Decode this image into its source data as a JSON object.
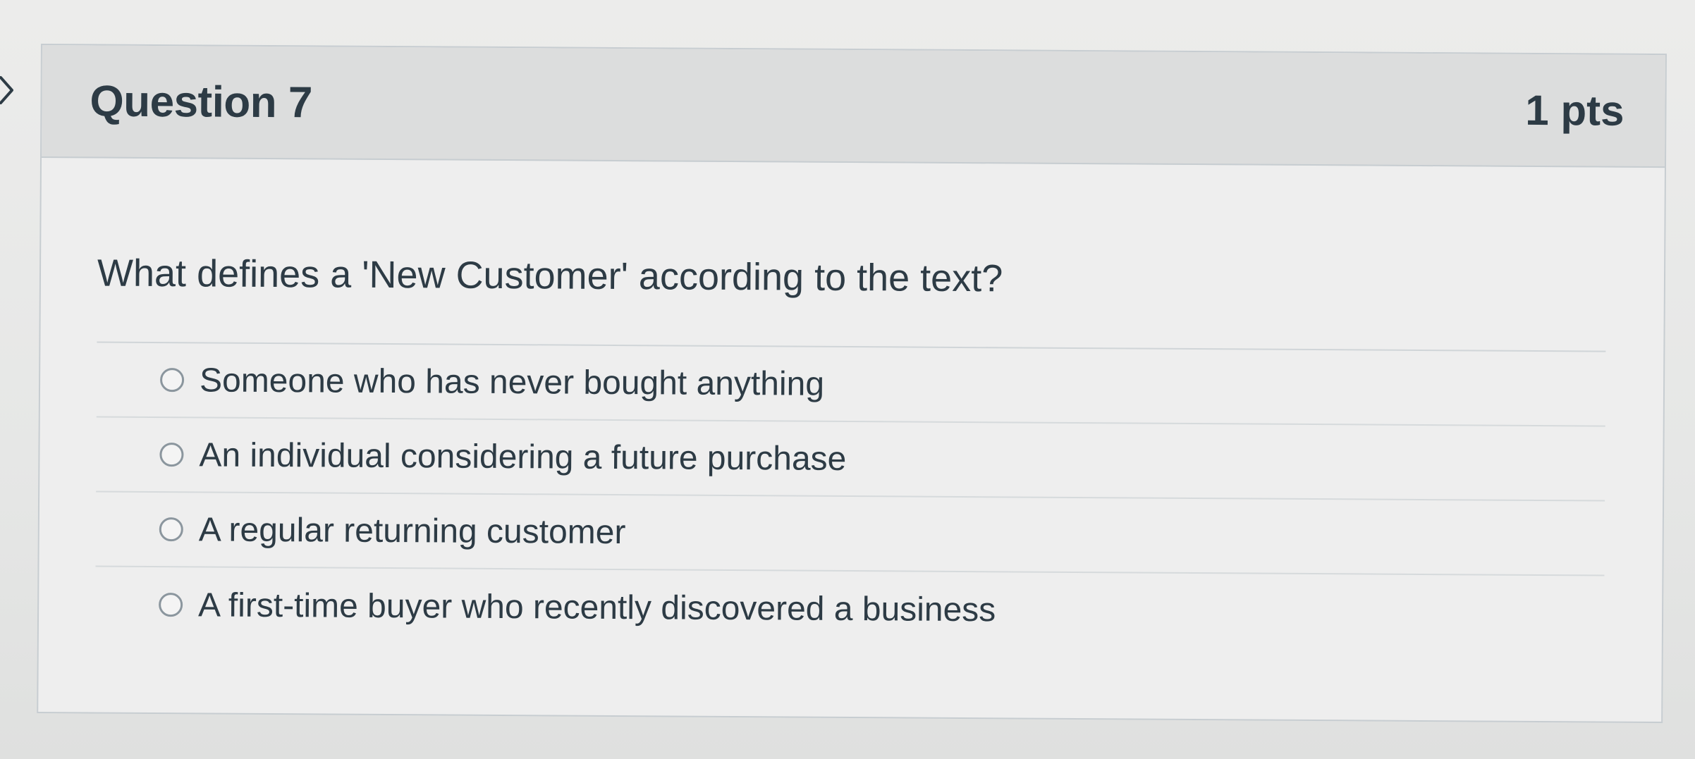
{
  "question": {
    "title": "Question 7",
    "points": "1 pts",
    "text": "What defines a 'New Customer' according to the text?"
  },
  "answers": [
    {
      "label": "Someone who has never bought anything",
      "selected": false
    },
    {
      "label": "An individual considering a future purchase",
      "selected": false
    },
    {
      "label": "A regular returning customer",
      "selected": false
    },
    {
      "label": "A first-time buyer who recently discovered a business",
      "selected": false
    }
  ],
  "icons": {
    "collapse_toggle": "chevron-right-icon",
    "answer_control": "radio-button-icon"
  },
  "colors": {
    "text": "#2d3b45",
    "header_bg": "#dcdddd",
    "border": "#c7cdd1",
    "radio_border": "#8b969e"
  }
}
